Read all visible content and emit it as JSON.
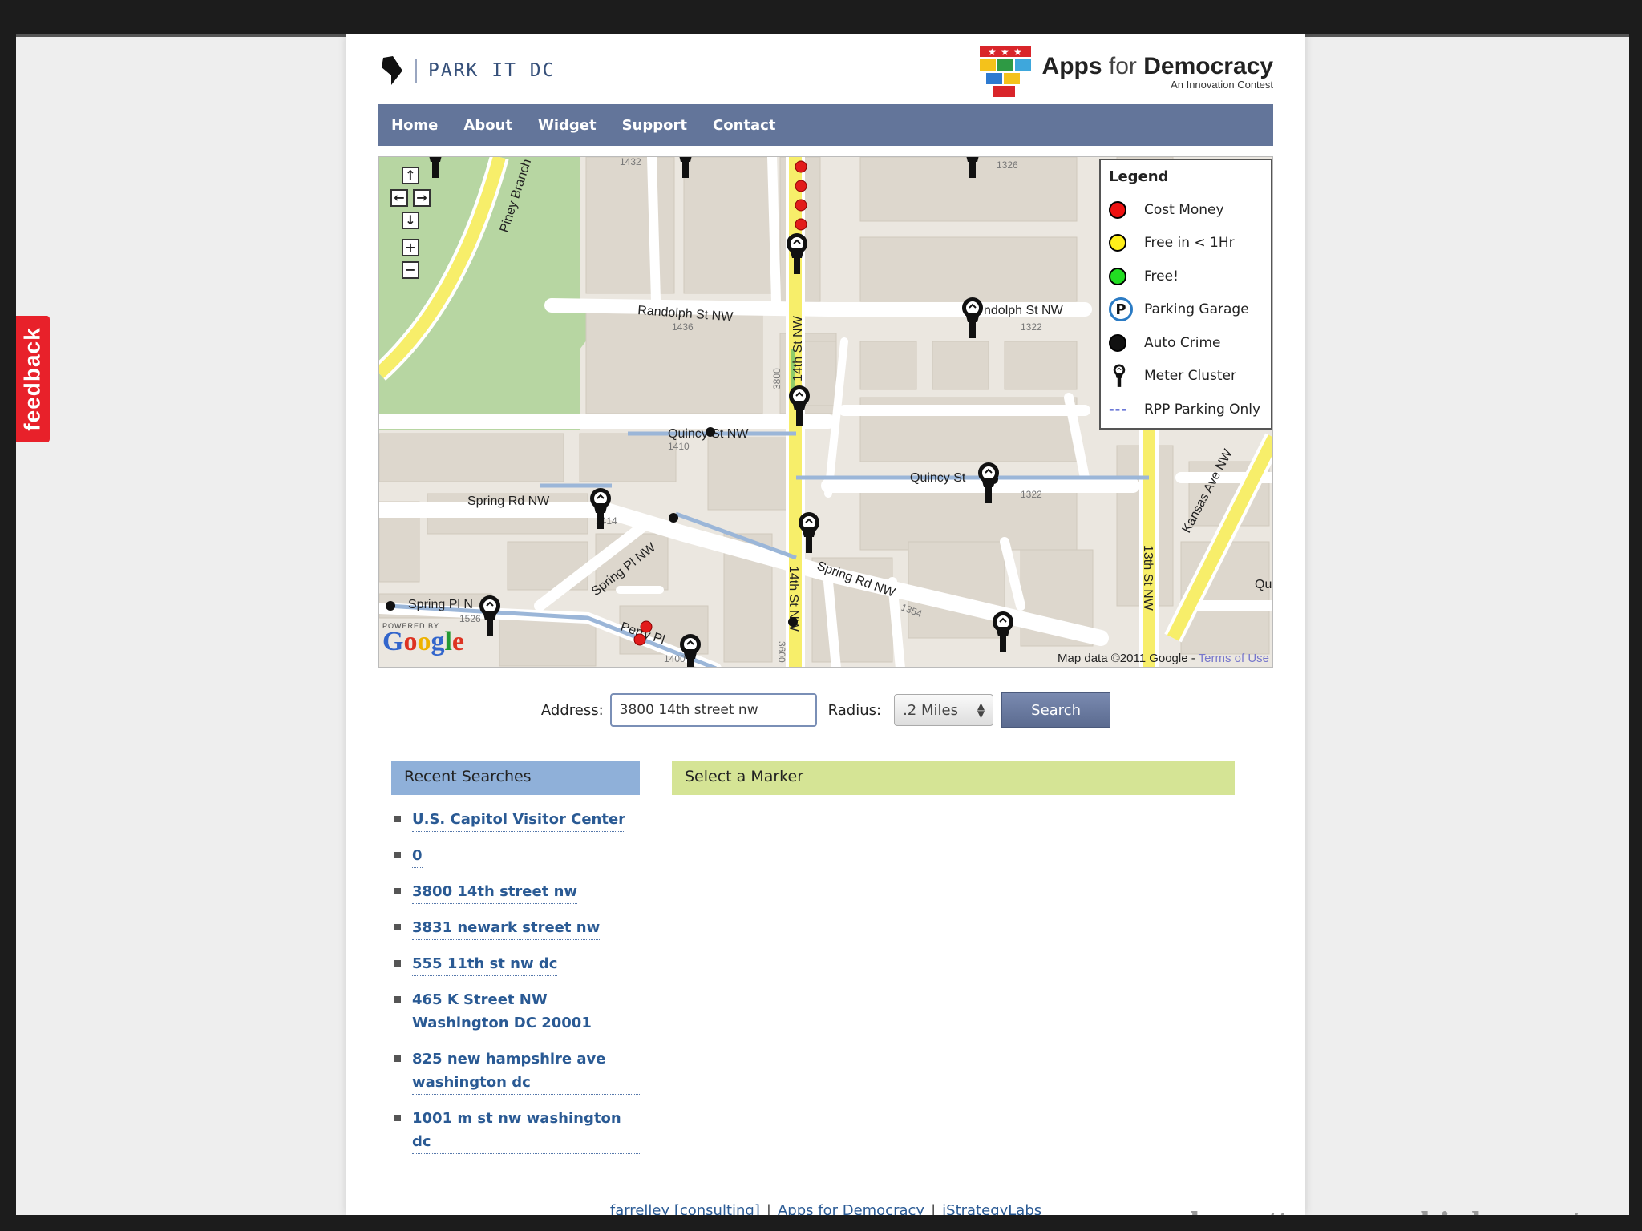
{
  "feedback": {
    "label": "feedback"
  },
  "header": {
    "site_name": "PARK IT DC",
    "partner_title_bold_1": "Apps",
    "partner_title_thin": "for",
    "partner_title_bold_2": "Democracy",
    "partner_subtitle": "An Innovation Contest"
  },
  "nav": {
    "items": [
      {
        "label": "Home"
      },
      {
        "label": "About"
      },
      {
        "label": "Widget"
      },
      {
        "label": "Support"
      },
      {
        "label": "Contact"
      }
    ]
  },
  "map": {
    "streets": {
      "piney_branch": "Piney Branch P",
      "randolph_w": "Randolph St NW",
      "randolph_e": "ndolph St NW",
      "quincy_w": "Quincy St NW",
      "quincy_e": "Quincy St",
      "spring_rd_w": "Spring Rd NW",
      "spring_rd_e": "Spring Rd NW",
      "spring_pl_ne": "Spring Pl NW",
      "spring_pl_w": "Spring Pl N",
      "perry_pl": "Perry Pl",
      "fourteenth_n": "14th St NW",
      "fourteenth_s": "14th St NW",
      "thirteenth": "13th St NW",
      "kansas": "Kansas Ave NW",
      "qu": "Qu"
    },
    "house_numbers": {
      "n1432": "1432",
      "n1326": "1326",
      "n1436": "1436",
      "n1322a": "1322",
      "n3800a": "3800",
      "n1410": "1410",
      "n1322b": "1322",
      "n1414": "1414",
      "n1354": "1354",
      "n1526": "1526",
      "n1400": "1400",
      "n3600": "3600"
    },
    "powered_by": "POWERED BY",
    "google": "Google",
    "attribution": "Map data ©2011 Google -",
    "terms_link": "Terms of Use"
  },
  "legend": {
    "title": "Legend",
    "items": [
      {
        "label": "Cost Money",
        "color": "#e11"
      },
      {
        "label": "Free in < 1Hr",
        "color": "#ffef1a"
      },
      {
        "label": "Free!",
        "color": "#22dd22"
      },
      {
        "label": "Parking Garage",
        "symbol": "P"
      },
      {
        "label": "Auto Crime",
        "color": "#111"
      },
      {
        "label": "Meter Cluster",
        "icon": "parking-meter-icon"
      },
      {
        "label": "RPP Parking Only",
        "symbol": "---"
      }
    ]
  },
  "search": {
    "address_label": "Address:",
    "address_value": "3800 14th street nw",
    "radius_label": "Radius:",
    "radius_value": ".2 Miles",
    "button_label": "Search"
  },
  "recent": {
    "title": "Recent Searches",
    "items": [
      "U.S. Capitol Visitor Center",
      "0",
      "3800 14th street nw",
      "3831 newark street nw",
      "555 11th st nw dc",
      "465 K Street NW Washington DC 20001",
      "825 new hampshire ave washington dc",
      "1001 m st nw washington dc"
    ]
  },
  "marker_panel": {
    "title": "Select a Marker"
  },
  "footer": {
    "link1": "farrelley [consulting]",
    "link2": "Apps for Democracy",
    "link3": "iStrategyLabs",
    "sep": "|"
  },
  "url_overlay": "http://www.parkitdc.com/"
}
